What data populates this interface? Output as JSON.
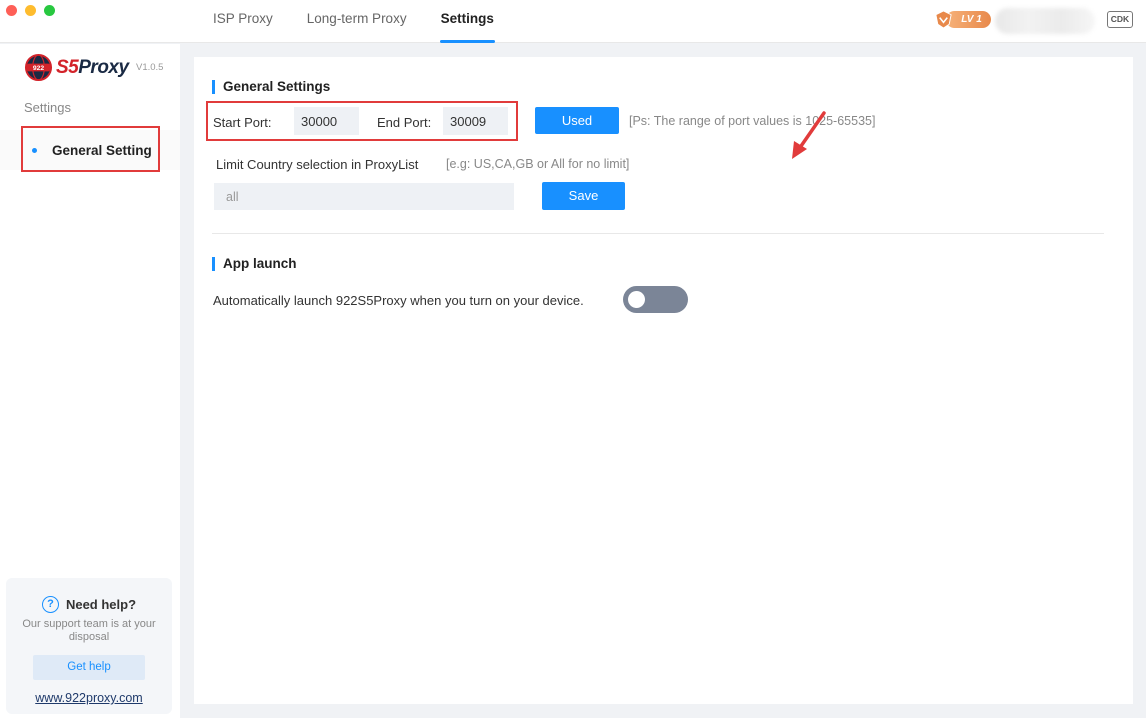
{
  "tabs": [
    {
      "label": "ISP Proxy",
      "active": false
    },
    {
      "label": "Long-term Proxy",
      "active": false
    },
    {
      "label": "Settings",
      "active": true
    }
  ],
  "header": {
    "level_badge": "LV 1",
    "cdk_label": "CDK"
  },
  "sidebar": {
    "logo_prefix": "S5",
    "logo_suffix": "Proxy",
    "logo_globe_text": "922",
    "version": "V1.0.5",
    "section_title": "Settings",
    "items": [
      {
        "label": "General Setting",
        "active": true
      }
    ]
  },
  "help": {
    "title": "Need help?",
    "description": "Our support team is at your disposal",
    "button_label": "Get help",
    "link_text": "www.922proxy.com"
  },
  "general_settings": {
    "title": "General Settings",
    "start_port_label": "Start Port:",
    "start_port_value": "30000",
    "end_port_label": "End Port:",
    "end_port_value": "30009",
    "used_button_label": "Used",
    "port_hint": "[Ps: The range of port values is 1025-65535]",
    "country_label": "Limit Country selection in ProxyList",
    "country_hint": "[e.g: US,CA,GB or All for no limit]",
    "country_value": "all",
    "save_button_label": "Save"
  },
  "app_launch": {
    "title": "App launch",
    "auto_launch_label": "Automatically launch 922S5Proxy when you turn on your device.",
    "auto_launch_enabled": false
  },
  "colors": {
    "accent": "#1890ff",
    "highlight_box": "#e13b3b",
    "toggle_off": "#7b8597"
  }
}
